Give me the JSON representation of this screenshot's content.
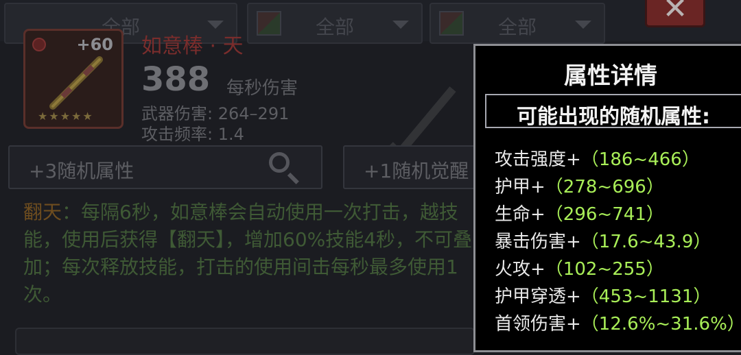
{
  "filters": [
    {
      "label": "全部"
    },
    {
      "label": "全部"
    },
    {
      "label": "全部"
    }
  ],
  "close_label": "✕",
  "item": {
    "name": "如意棒 · 天",
    "enhance": "+60",
    "stars": "★★★★★",
    "dps": "388",
    "dps_label": "每秒伤害",
    "weapon_damage_label": "武器伤害:",
    "weapon_damage": "264–291",
    "attack_rate_label": "攻击频率:",
    "attack_rate": "1.4"
  },
  "random_attr_button": "+3随机属性",
  "awaken_attr_button": "+1随机觉醒",
  "description": {
    "keyword": "翻天",
    "text": "：每隔6秒，如意棒会自动使用一次打击，越技能，使用后获得【翻天】，增加60%技能4秒，不可叠加；每次释放技能，打击的使用间击每秒最多使用1次。"
  },
  "tooltip": {
    "title": "属性详情",
    "subheading": "可能出现的随机属性:",
    "attributes": [
      {
        "name": "攻击强度+",
        "range": "（186~466）"
      },
      {
        "name": "护甲+",
        "range": "（278~696）"
      },
      {
        "name": "生命+",
        "range": "（296~741）"
      },
      {
        "name": "暴击伤害+",
        "range": "（17.6~43.9）"
      },
      {
        "name": "火攻+",
        "range": "（102~255）"
      },
      {
        "name": "护甲穿透+",
        "range": "（453~1131）"
      },
      {
        "name": "首领伤害+",
        "range": "（12.6%~31.6%）"
      }
    ]
  },
  "colors": {
    "tooltip_bg": "#000000",
    "tooltip_value": "#a9ef58",
    "item_name_dim": "#7a2d2c"
  }
}
